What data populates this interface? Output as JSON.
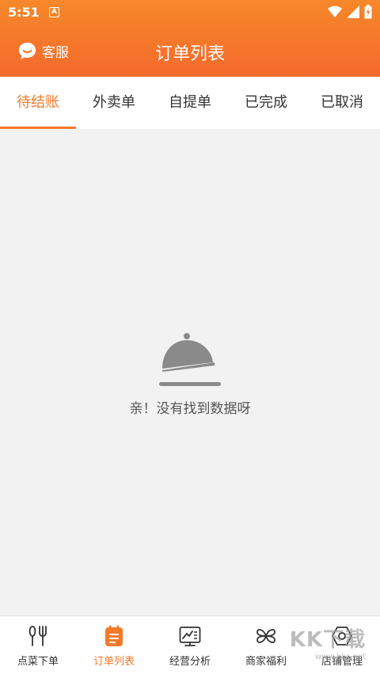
{
  "status": {
    "time": "5:51",
    "a_badge": "A"
  },
  "header": {
    "service_label": "客服",
    "title": "订单列表"
  },
  "tabs": [
    {
      "label": "待结账",
      "active": true
    },
    {
      "label": "外卖单",
      "active": false
    },
    {
      "label": "自提单",
      "active": false
    },
    {
      "label": "已完成",
      "active": false
    },
    {
      "label": "已取消",
      "active": false
    }
  ],
  "empty_state": {
    "message": "亲！没有找到数据呀",
    "icon": "cloche-icon"
  },
  "bottom_nav": [
    {
      "label": "点菜下单",
      "icon": "fork-knife-icon",
      "active": false
    },
    {
      "label": "订单列表",
      "icon": "order-list-icon",
      "active": true
    },
    {
      "label": "经营分析",
      "icon": "analysis-icon",
      "active": false
    },
    {
      "label": "商家福利",
      "icon": "clover-icon",
      "active": false
    },
    {
      "label": "店铺管理",
      "icon": "settings-hex-icon",
      "active": false
    }
  ],
  "watermark": {
    "main": "KK下载",
    "sub": "www.kkx.net"
  },
  "colors": {
    "accent": "#f47a2a",
    "header_top": "#f7882a",
    "header_bottom": "#f46a2c",
    "background": "#f2f2f2"
  }
}
